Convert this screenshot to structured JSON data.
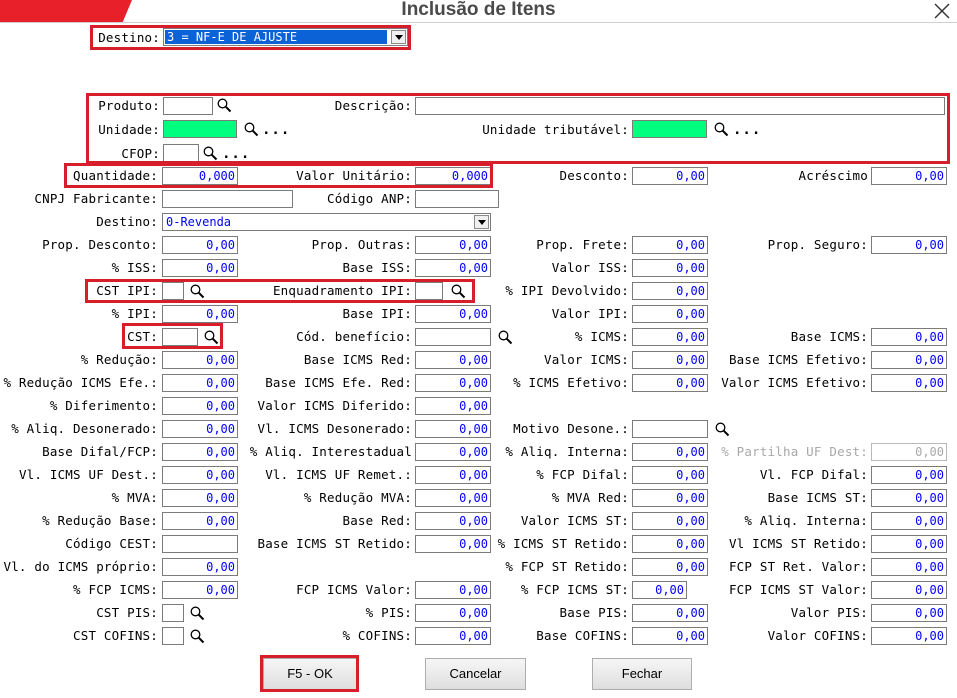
{
  "window": {
    "title": "Inclusão de Itens"
  },
  "colors": {
    "accent_red": "#e8202a",
    "highlight_red": "#d71f2b",
    "value_blue": "#0000ff",
    "unit_green": "#00ff7f",
    "selection_blue": "#0a62d6"
  },
  "destino_top": {
    "label": "Destino:",
    "value": "3 = NF-E DE AJUSTE"
  },
  "produto": {
    "label": "Produto:",
    "value": ""
  },
  "descricao": {
    "label": "Descrição:",
    "value": ""
  },
  "unidade": {
    "label": "Unidade:",
    "value": ""
  },
  "unidade_trib": {
    "label": "Unidade tributável:",
    "value": ""
  },
  "cfop": {
    "label": "CFOP:",
    "value": ""
  },
  "dots": "...",
  "quantidade": {
    "label": "Quantidade:",
    "value": "0,000"
  },
  "valor_unitario": {
    "label": "Valor Unitário:",
    "value": "0,000"
  },
  "desconto": {
    "label": "Desconto:",
    "value": "0,00"
  },
  "acrescimo": {
    "label": "Acréscimo",
    "value": "0,00"
  },
  "cnpj_fabricante": {
    "label": "CNPJ Fabricante:",
    "value": ""
  },
  "codigo_anp": {
    "label": "Código ANP:",
    "value": ""
  },
  "destino2": {
    "label": "Destino:",
    "value": "0-Revenda"
  },
  "prop_desconto": {
    "label": "Prop. Desconto:",
    "value": "0,00"
  },
  "prop_outras": {
    "label": "Prop. Outras:",
    "value": "0,00"
  },
  "prop_frete": {
    "label": "Prop. Frete:",
    "value": "0,00"
  },
  "prop_seguro": {
    "label": "Prop. Seguro:",
    "value": "0,00"
  },
  "pct_iss": {
    "label": "% ISS:",
    "value": "0,00"
  },
  "base_iss": {
    "label": "Base ISS:",
    "value": "0,00"
  },
  "valor_iss": {
    "label": "Valor ISS:",
    "value": "0,00"
  },
  "cst_ipi": {
    "label": "CST IPI:",
    "value": ""
  },
  "enquadramento_ipi": {
    "label": "Enquadramento IPI:",
    "value": ""
  },
  "pct_ipi_devolvido": {
    "label": "% IPI Devolvido:",
    "value": "0,00"
  },
  "pct_ipi": {
    "label": "% IPI:",
    "value": "0,00"
  },
  "base_ipi": {
    "label": "Base IPI:",
    "value": "0,00"
  },
  "valor_ipi": {
    "label": "Valor IPI:",
    "value": "0,00"
  },
  "cst": {
    "label": "CST:",
    "value": ""
  },
  "cod_beneficio": {
    "label": "Cód. benefício:",
    "value": ""
  },
  "pct_icms": {
    "label": "% ICMS:",
    "value": "0,00"
  },
  "base_icms": {
    "label": "Base ICMS:",
    "value": "0,00"
  },
  "pct_reducao": {
    "label": "% Redução:",
    "value": "0,00"
  },
  "base_icms_red": {
    "label": "Base ICMS Red:",
    "value": "0,00"
  },
  "valor_icms": {
    "label": "Valor ICMS:",
    "value": "0,00"
  },
  "base_icms_efetivo": {
    "label": "Base ICMS Efetivo:",
    "value": "0,00"
  },
  "pct_reducao_icms_efe": {
    "label": "% Redução ICMS Efe.:",
    "value": "0,00"
  },
  "base_icms_efe_red": {
    "label": "Base ICMS Efe. Red:",
    "value": "0,00"
  },
  "pct_icms_efetivo": {
    "label": "% ICMS Efetivo:",
    "value": "0,00"
  },
  "valor_icms_efetivo": {
    "label": "Valor ICMS Efetivo:",
    "value": "0,00"
  },
  "pct_diferimento": {
    "label": "% Diferimento:",
    "value": "0,00"
  },
  "valor_icms_diferido": {
    "label": "Valor ICMS Diferido:",
    "value": "0,00"
  },
  "pct_aliq_desonerado": {
    "label": "% Aliq. Desonerado:",
    "value": "0,00"
  },
  "vl_icms_desonerado": {
    "label": "Vl. ICMS Desonerado:",
    "value": "0,00"
  },
  "motivo_desone": {
    "label": "Motivo Desone.:",
    "value": ""
  },
  "base_difal_fcp": {
    "label": "Base Difal/FCP:",
    "value": "0,00"
  },
  "pct_aliq_interestadual": {
    "label": "% Aliq. Interestadual",
    "value": "0,00"
  },
  "pct_aliq_interna": {
    "label": "% Aliq. Interna:",
    "value": "0,00"
  },
  "pct_partilha_uf_dest": {
    "label": "% Partilha UF Dest:",
    "value": "0,00"
  },
  "vl_icms_uf_dest": {
    "label": "Vl. ICMS UF Dest.:",
    "value": "0,00"
  },
  "vl_icms_uf_remet": {
    "label": "Vl. ICMS UF Remet.:",
    "value": "0,00"
  },
  "pct_fcp_difal": {
    "label": "% FCP Difal:",
    "value": "0,00"
  },
  "vl_fcp_difal": {
    "label": "Vl. FCP Difal:",
    "value": "0,00"
  },
  "pct_mva": {
    "label": "% MVA:",
    "value": "0,00"
  },
  "pct_reducao_mva": {
    "label": "% Redução MVA:",
    "value": "0,00"
  },
  "pct_mva_red": {
    "label": "% MVA Red:",
    "value": "0,00"
  },
  "base_icms_st": {
    "label": "Base ICMS ST:",
    "value": "0,00"
  },
  "pct_reducao_base": {
    "label": "% Redução Base:",
    "value": "0,00"
  },
  "base_red": {
    "label": "Base Red:",
    "value": "0,00"
  },
  "valor_icms_st": {
    "label": "Valor ICMS ST:",
    "value": "0,00"
  },
  "pct_aliq_interna_st": {
    "label": "% Aliq. Interna:",
    "value": "0,00"
  },
  "codigo_cest": {
    "label": "Código CEST:",
    "value": ""
  },
  "base_icms_st_retido": {
    "label": "Base ICMS ST Retido:",
    "value": "0,00"
  },
  "pct_icms_st_retido": {
    "label": "% ICMS ST Retido:",
    "value": "0,00"
  },
  "vl_icms_st_retido": {
    "label": "Vl ICMS ST Retido:",
    "value": "0,00"
  },
  "vl_icms_proprio": {
    "label": "Vl. do ICMS próprio:",
    "value": "0,00"
  },
  "pct_fcp_st_retido": {
    "label": "% FCP ST Retido:",
    "value": "0,00"
  },
  "fcp_st_ret_valor": {
    "label": "FCP ST Ret. Valor:",
    "value": "0,00"
  },
  "pct_fcp_icms": {
    "label": "% FCP ICMS:",
    "value": "0,00"
  },
  "fcp_icms_valor": {
    "label": "FCP ICMS Valor:",
    "value": "0,00"
  },
  "pct_fcp_icms_st": {
    "label": "% FCP ICMS ST:",
    "value": "0,00"
  },
  "fcp_icms_st_valor": {
    "label": "FCP ICMS ST Valor:",
    "value": "0,00"
  },
  "cst_pis": {
    "label": "CST PIS:",
    "value": ""
  },
  "pct_pis": {
    "label": "% PIS:",
    "value": "0,00"
  },
  "base_pis": {
    "label": "Base PIS:",
    "value": "0,00"
  },
  "valor_pis": {
    "label": "Valor PIS:",
    "value": "0,00"
  },
  "cst_cofins": {
    "label": "CST COFINS:",
    "value": ""
  },
  "pct_cofins": {
    "label": "% COFINS:",
    "value": "0,00"
  },
  "base_cofins": {
    "label": "Base COFINS:",
    "value": "0,00"
  },
  "valor_cofins": {
    "label": "Valor COFINS:",
    "value": "0,00"
  },
  "buttons": {
    "ok": "F5 - OK",
    "cancel": "Cancelar",
    "close": "Fechar"
  },
  "icons": {
    "lookup": "magnifier-icon",
    "close": "close-x-icon",
    "dropdown": "chevron-down-icon"
  }
}
